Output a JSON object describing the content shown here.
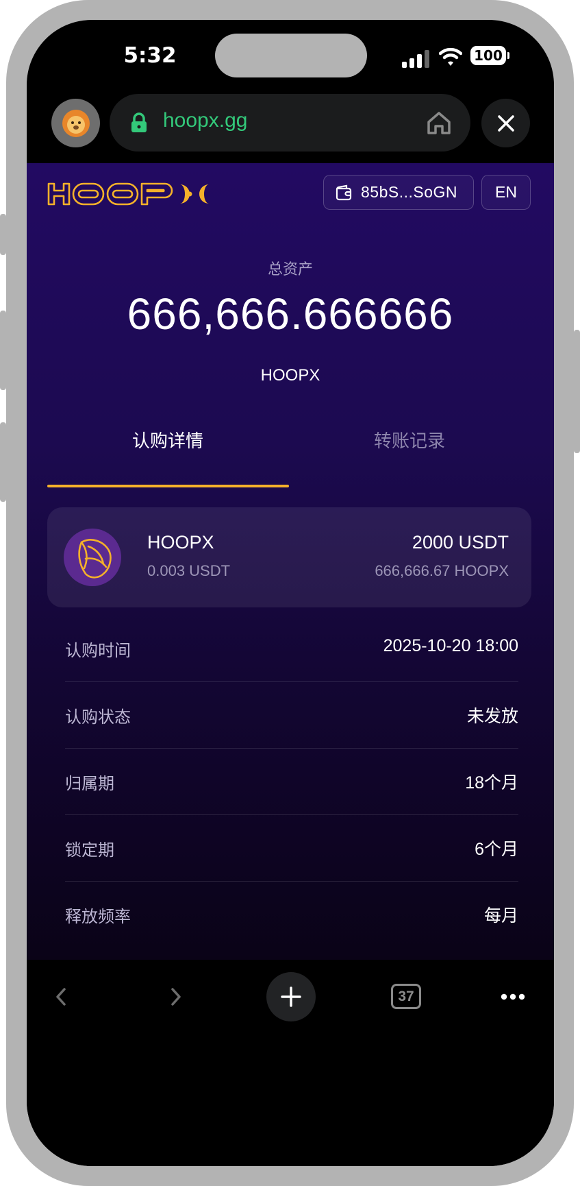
{
  "status_bar": {
    "time": "5:32",
    "battery": "100"
  },
  "browser": {
    "url": "hoopx.gg",
    "tab_count": "37"
  },
  "header": {
    "wallet_address": "85bS...SoGN",
    "language": "EN"
  },
  "summary": {
    "label": "总资产",
    "value": "666,666.666666",
    "unit": "HOOPX"
  },
  "tabs": [
    {
      "label": "认购详情",
      "active": true
    },
    {
      "label": "转账记录",
      "active": false
    }
  ],
  "token": {
    "name": "HOOPX",
    "price": "0.003 USDT",
    "amount": "2000 USDT",
    "quantity": "666,666.67 HOOPX"
  },
  "details": [
    {
      "label": "认购时间",
      "value": "2025-10-20 18:00"
    },
    {
      "label": "认购状态",
      "value": "未发放"
    },
    {
      "label": "归属期",
      "value": "18个月"
    },
    {
      "label": "锁定期",
      "value": "6个月"
    },
    {
      "label": "释放频率",
      "value": "每月"
    }
  ],
  "colors": {
    "accent": "#f5b12a",
    "url_green": "#33c97a",
    "background_top": "#220a62",
    "background_bottom": "#0a0317"
  },
  "icons": {
    "avatar": "lion-face-icon",
    "lock": "lock-icon",
    "home": "home-icon",
    "close": "close-icon",
    "wallet": "wallet-icon",
    "token": "basketball-icon",
    "back": "chevron-left-icon",
    "forward": "chevron-right-icon",
    "add": "plus-icon",
    "more": "more-horizontal-icon"
  }
}
